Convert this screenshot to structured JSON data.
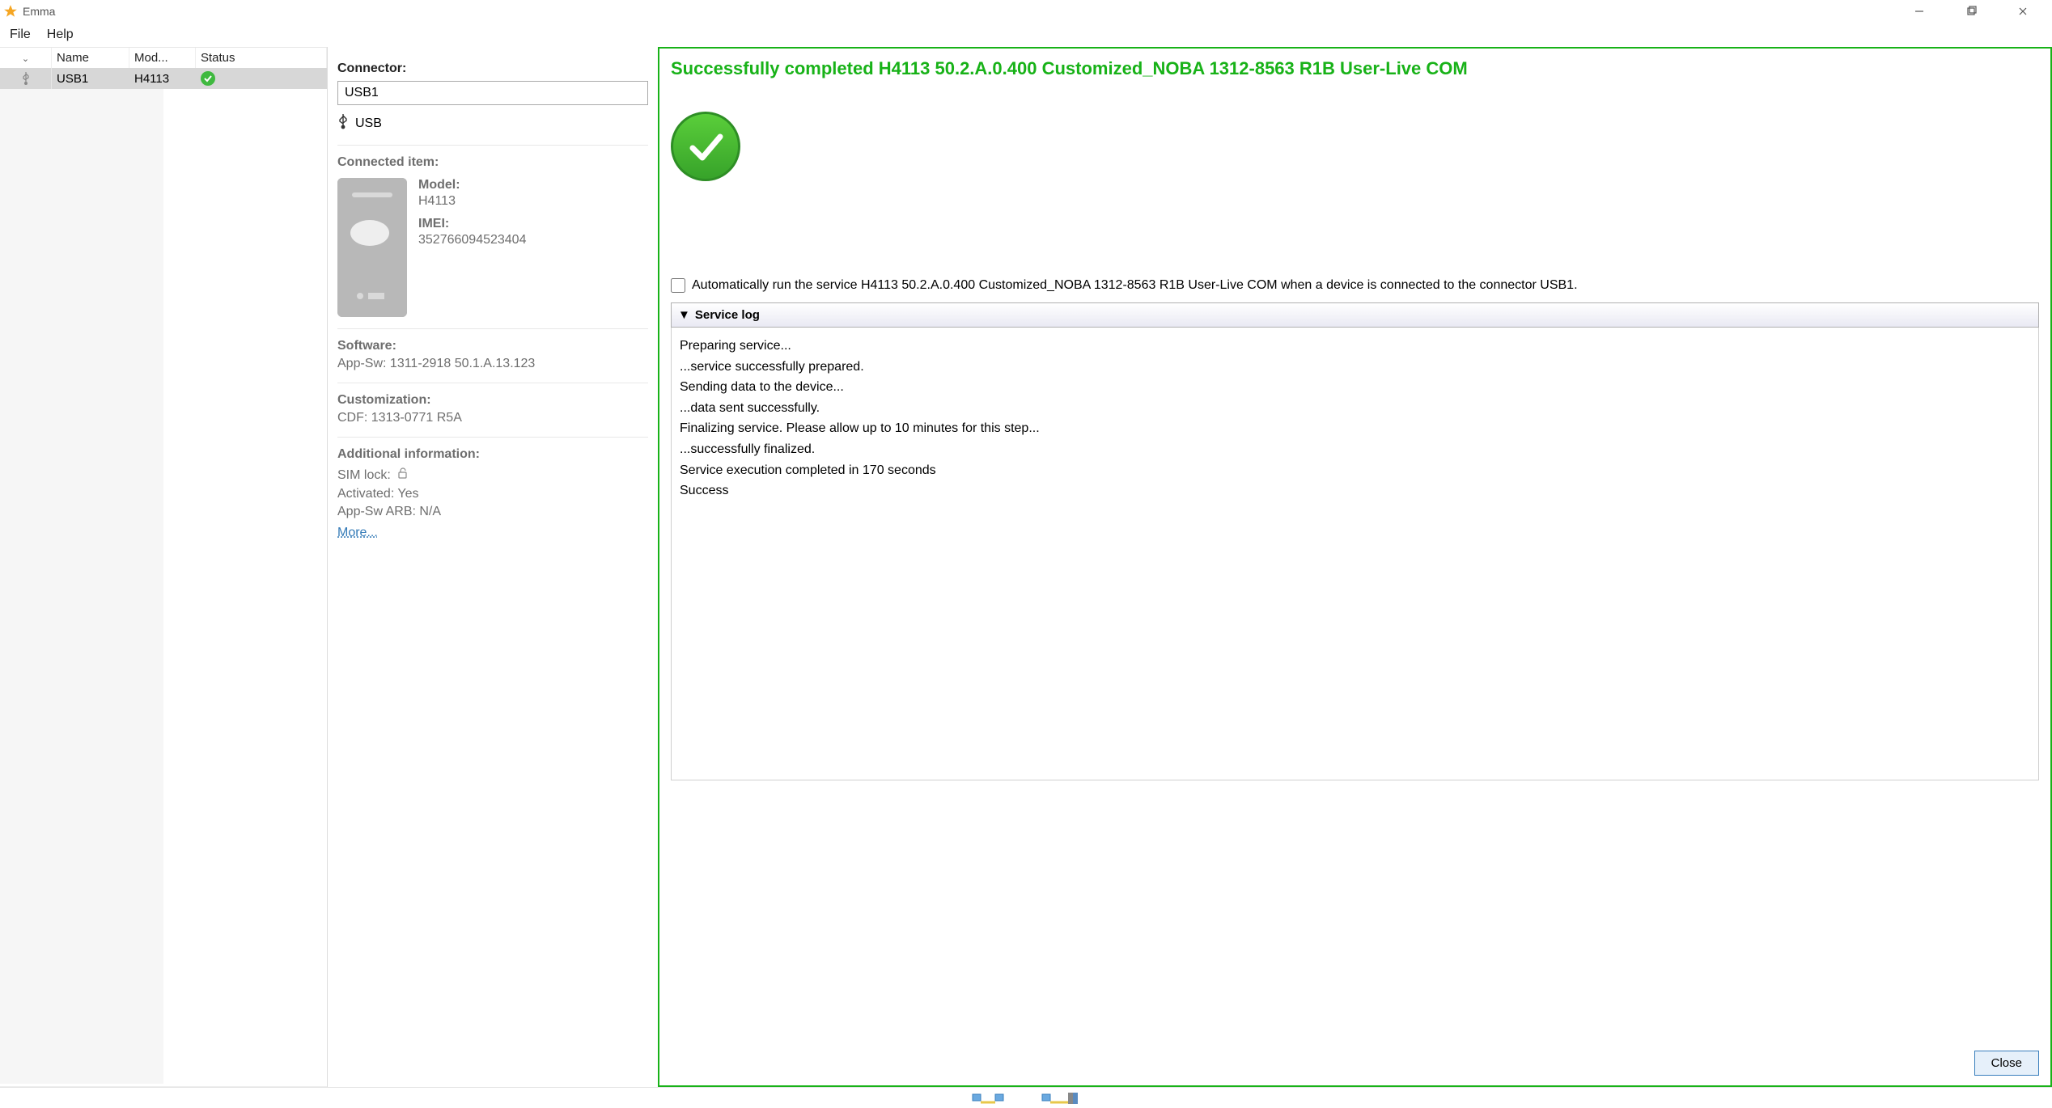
{
  "window": {
    "title": "Emma"
  },
  "menu": {
    "file": "File",
    "help": "Help"
  },
  "deviceTable": {
    "headers": {
      "name": "Name",
      "model": "Mod...",
      "status": "Status"
    },
    "row": {
      "name": "USB1",
      "model": "H4113"
    }
  },
  "mid": {
    "connectorLabel": "Connector:",
    "connectorValue": "USB1",
    "connectorType": "USB",
    "connectedLabel": "Connected item:",
    "modelLabel": "Model:",
    "modelValue": "H4113",
    "imeiLabel": "IMEI:",
    "imeiValue": "352766094523404",
    "softwareLabel": "Software:",
    "softwareValue": "App-Sw: 1311-2918 50.1.A.13.123",
    "customizationLabel": "Customization:",
    "customizationValue": "CDF: 1313-0771 R5A",
    "additionalLabel": "Additional information:",
    "simLockLabel": "SIM lock:",
    "activatedLine": "Activated: Yes",
    "arbLine": "App-Sw ARB: N/A",
    "moreLink": "More..."
  },
  "right": {
    "heading": "Successfully completed H4113 50.2.A.0.400 Customized_NOBA 1312-8563 R1B User-Live COM",
    "autoRunText": "Automatically run the service H4113 50.2.A.0.400 Customized_NOBA 1312-8563 R1B User-Live COM when a device is connected to the connector USB1.",
    "serviceLogHeader": "Service log",
    "logLines": {
      "l1": "Preparing service...",
      "l2": "...service successfully prepared.",
      "l3": "Sending data to the device...",
      "l4": "...data sent successfully.",
      "l5": "Finalizing service. Please allow up to 10 minutes for this step...",
      "l6": "...successfully finalized.",
      "l7": "Service execution completed in 170 seconds",
      "l8": "Success"
    },
    "closeBtn": "Close"
  }
}
